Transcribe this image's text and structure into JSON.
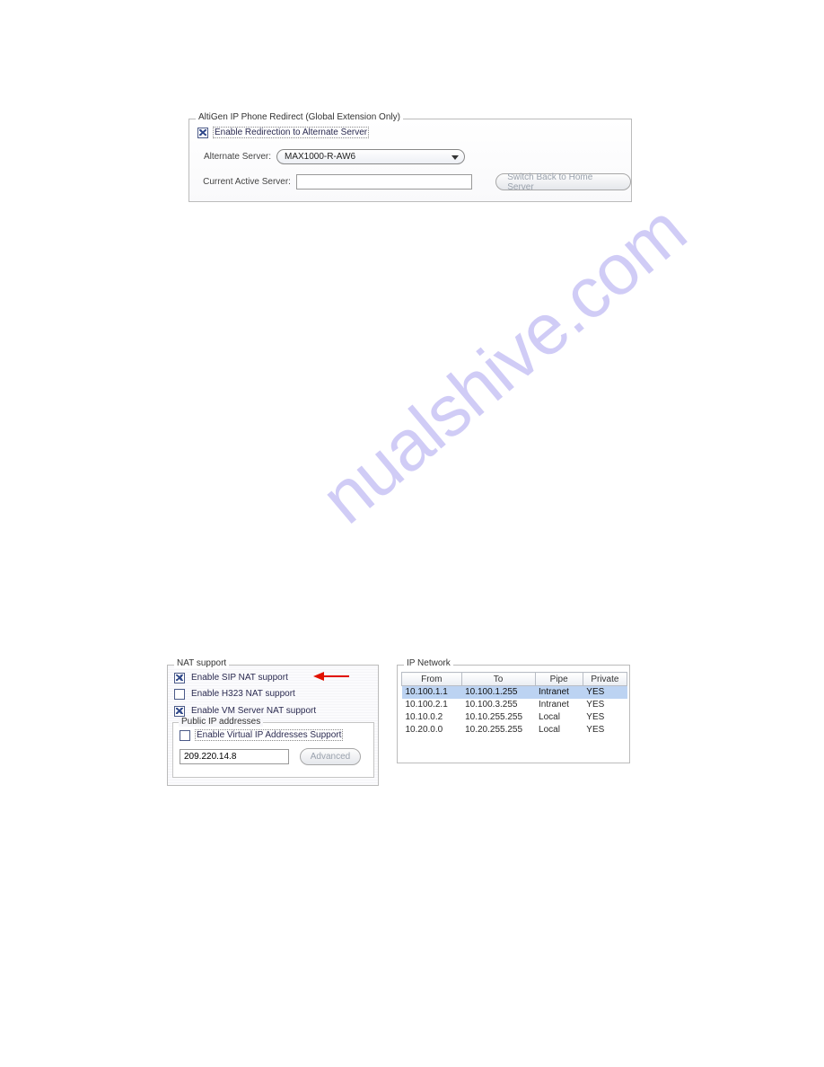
{
  "watermark": "nualshive.com",
  "redirect": {
    "group_title": "AltiGen IP Phone Redirect (Global Extension Only)",
    "enable_label": "Enable Redirection to Alternate Server",
    "alternate_label": "Alternate Server:",
    "alternate_value": "MAX1000-R-AW6",
    "current_label": "Current Active Server:",
    "current_value": "",
    "switch_button": "Switch Back to Home Server"
  },
  "nat": {
    "group_title": "NAT support",
    "sip_label": "Enable SIP NAT support",
    "h323_label": "Enable H323 NAT support",
    "vm_label": "Enable VM Server NAT support",
    "public_group_title": "Public IP addresses",
    "virtual_label": "Enable Virtual IP Addresses Support",
    "ip_value": "209.220.14.8",
    "advanced_button": "Advanced"
  },
  "ipnet": {
    "group_title": "IP Network",
    "headers": {
      "c1": "From",
      "c2": "To",
      "c3": "Pipe",
      "c4": "Private"
    },
    "rows": [
      {
        "from": "10.100.1.1",
        "to": "10.100.1.255",
        "pipe": "Intranet",
        "priv": "YES"
      },
      {
        "from": "10.100.2.1",
        "to": "10.100.3.255",
        "pipe": "Intranet",
        "priv": "YES"
      },
      {
        "from": "10.10.0.2",
        "to": "10.10.255.255",
        "pipe": "Local",
        "priv": "YES"
      },
      {
        "from": "10.20.0.0",
        "to": "10.20.255.255",
        "pipe": "Local",
        "priv": "YES"
      }
    ]
  }
}
